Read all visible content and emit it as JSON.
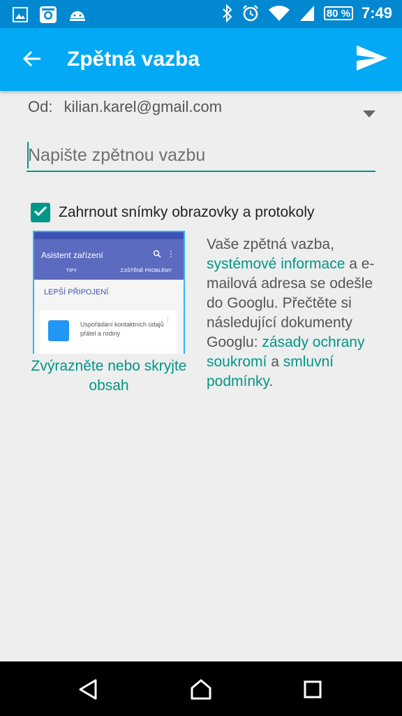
{
  "status_bar": {
    "icons_left": [
      "gallery-icon",
      "instagram-icon",
      "android-icon"
    ],
    "icons_right": [
      "bluetooth-icon",
      "alarm-icon",
      "wifi-icon",
      "signal-icon"
    ],
    "battery": "80 %",
    "time": "7:49"
  },
  "app_bar": {
    "title": "Zpětná vazba"
  },
  "from": {
    "label": "Od:",
    "email": "kilian.karel@gmail.com"
  },
  "feedback": {
    "value": "",
    "placeholder": "Napište zpětnou vazbu"
  },
  "screenshot_option": {
    "checked": true,
    "label": "Zahrnout snímky obrazovky a protokoly"
  },
  "preview": {
    "title": "Asistent zařízení",
    "tab1": "TIPY",
    "tab2": "ZJIŠTĚNÉ PROBLÉMY",
    "section": "LEPŠÍ PŘIPOJENÍ",
    "card_text": "Uspořádání kontaktních údajů přátel a rodiny",
    "highlight_link": "Zvýrazněte nebo skryjte obsah"
  },
  "info": {
    "part1": "Vaše zpětná vazba,",
    "link_system": "systémové informace",
    "part2": "a e-mailová adresa se odešle do Googlu. Přečtěte si následující dokumenty Googlu:",
    "link_privacy": "zásady ochrany soukromí",
    "part3": "a",
    "link_terms": "smluvní podmínky",
    "end": "."
  },
  "colors": {
    "status_bar": "#0288d1",
    "app_bar": "#03a9f4",
    "accent": "#009688",
    "background": "#eeeeee"
  }
}
